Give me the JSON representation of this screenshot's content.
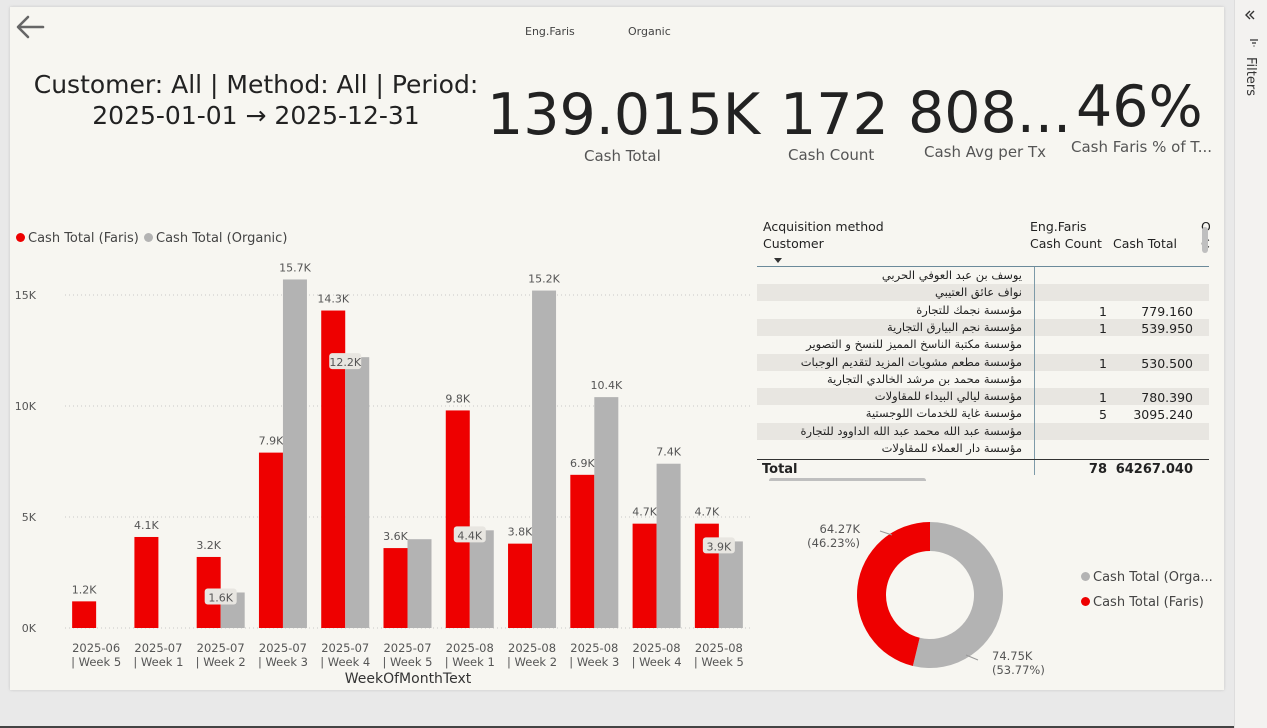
{
  "header": {
    "legend_items": [
      "Eng.Faris",
      "Organic"
    ],
    "filter_summary": "Customer: All | Method: All | Period: 2025-01-01 → 2025-12-31"
  },
  "kpis": [
    {
      "value": "139.015K",
      "label": "Cash Total"
    },
    {
      "value": "172",
      "label": "Cash Count"
    },
    {
      "value": "808...",
      "label": "Cash Avg per Tx"
    },
    {
      "value": "46%",
      "label": "Cash Faris % of T..."
    }
  ],
  "chart_data": [
    {
      "type": "bar",
      "title": "",
      "xlabel": "WeekOfMonthText",
      "ylabel": "",
      "ylim": [
        0,
        16500
      ],
      "yticks": [
        "0K",
        "5K",
        "10K",
        "15K"
      ],
      "ytick_values": [
        0,
        5000,
        10000,
        15000
      ],
      "legend_position": "top-left",
      "categories": [
        "2025-06 | Week 5",
        "2025-07 | Week 1",
        "2025-07 | Week 2",
        "2025-07 | Week 3",
        "2025-07 | Week 4",
        "2025-07 | Week 5",
        "2025-08 | Week 1",
        "2025-08 | Week 2",
        "2025-08 | Week 3",
        "2025-08 | Week 4",
        "2025-08 | Week 5"
      ],
      "category_lines": [
        [
          "2025-06",
          "| Week 5"
        ],
        [
          "2025-07",
          "| Week 1"
        ],
        [
          "2025-07",
          "| Week 2"
        ],
        [
          "2025-07",
          "| Week 3"
        ],
        [
          "2025-07",
          "| Week 4"
        ],
        [
          "2025-07",
          "| Week 5"
        ],
        [
          "2025-08",
          "| Week 1"
        ],
        [
          "2025-08",
          "| Week 2"
        ],
        [
          "2025-08",
          "| Week 3"
        ],
        [
          "2025-08",
          "| Week 4"
        ],
        [
          "2025-08",
          "| Week 5"
        ]
      ],
      "series": [
        {
          "name": "Cash Total (Faris)",
          "color": "#ee0000",
          "values": [
            1200,
            4100,
            3200,
            7900,
            14300,
            3600,
            9800,
            3800,
            6900,
            4700,
            4700
          ],
          "labels": [
            "1.2K",
            "4.1K",
            "3.2K",
            "7.9K",
            "14.3K",
            "3.6K",
            "9.8K",
            "3.8K",
            "6.9K",
            "4.7K",
            "4.7K"
          ]
        },
        {
          "name": "Cash Total (Organic)",
          "color": "#b3b3b3",
          "values": [
            null,
            null,
            1600,
            15700,
            12200,
            4000,
            4400,
            15200,
            10400,
            7400,
            3900
          ],
          "labels": [
            null,
            null,
            "1.6K",
            "15.7K",
            "12.2K",
            null,
            "4.4K",
            "15.2K",
            "10.4K",
            "7.4K",
            "3.9K"
          ]
        }
      ]
    },
    {
      "type": "pie",
      "title": "",
      "legend_position": "right",
      "slices": [
        {
          "name": "Cash Total (Orga...",
          "value": 74.75,
          "label": "74.75K",
          "pct": "(53.77%)",
          "color": "#b3b3b3"
        },
        {
          "name": "Cash Total (Faris)",
          "value": 64.27,
          "label": "64.27K",
          "pct": "(46.23%)",
          "color": "#ee0000"
        }
      ]
    }
  ],
  "table": {
    "header_row1": {
      "method": "Acquisition method",
      "group1": "Eng.Faris",
      "group2": "O"
    },
    "header_row2": {
      "customer": "Customer",
      "count": "Cash Count",
      "total": "Cash Total",
      "col3": "C"
    },
    "rows": [
      {
        "customer": "يوسف بن عبد العوفي الحربي",
        "count": "",
        "total": ""
      },
      {
        "customer": "نواف عائق العتيبي",
        "count": "",
        "total": ""
      },
      {
        "customer": "مؤسسة نجمك للتجارة",
        "count": "1",
        "total": "779.160"
      },
      {
        "customer": "مؤسسة نجم البيارق التجارية",
        "count": "1",
        "total": "539.950"
      },
      {
        "customer": "مؤسسة مكتبة الناسخ المميز للنسخ و التصوير",
        "count": "",
        "total": ""
      },
      {
        "customer": "مؤسسة مطعم مشويات المزيد لتقديم الوجبات",
        "count": "1",
        "total": "530.500"
      },
      {
        "customer": "مؤسسة محمد بن مرشد الخالدي التجارية",
        "count": "",
        "total": ""
      },
      {
        "customer": "مؤسسة ليالي البيداء للمقاولات",
        "count": "1",
        "total": "780.390"
      },
      {
        "customer": "مؤسسة غاية للخدمات اللوجستية",
        "count": "5",
        "total": "3095.240"
      },
      {
        "customer": "مؤسسة عبد الله محمد عبد الله الداوود للتجارة",
        "count": "",
        "total": ""
      },
      {
        "customer": "مؤسسة دار العملاء للمقاولات",
        "count": "",
        "total": ""
      }
    ],
    "total": {
      "label": "Total",
      "count": "78",
      "total": "64267.040"
    }
  },
  "side_pane": {
    "label": "Filters"
  }
}
